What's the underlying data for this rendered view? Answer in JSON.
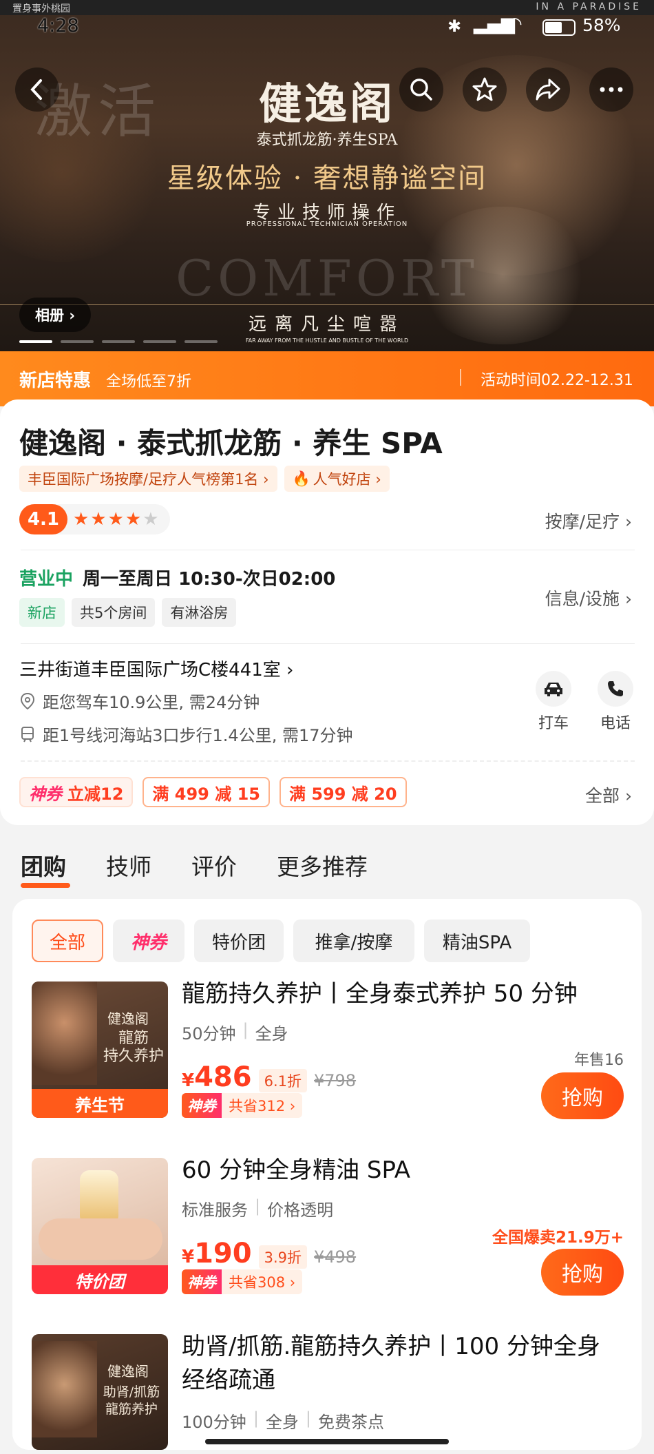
{
  "status_bar": {
    "top_left": "置身事外桃园",
    "top_right": "IN A PARADISE",
    "time": "4:28",
    "battery": "58%"
  },
  "hero": {
    "watermark_left": "激活",
    "logo_text": "健逸阁",
    "logo_sub": "泰式抓龙筋·养生SPA",
    "slogan": "星级体验 · 奢想静谧空间",
    "subline_cn": "专业技师操作",
    "subline_en": "PROFESSIONAL TECHNICIAN OPERATION",
    "watermark_en": "COMFORT",
    "bottom_cn": "远离凡尘喧嚣",
    "bottom_en": "FAR AWAY FROM THE HUSTLE AND BUSTLE OF THE WORLD",
    "album_label": "相册 ›"
  },
  "promo": {
    "title": "新店特惠",
    "desc": "全场低至7折",
    "period": "活动时间02.22-12.31"
  },
  "shop": {
    "name": "健逸阁 · 泰式抓龙筋 · 养生 SPA",
    "rank_tag": "丰臣国际广场按摩/足疗人气榜第1名 ›",
    "hot_tag": "人气好店 ›",
    "rating": "4.1",
    "category": "按摩/足疗 ›",
    "open_status": "营业中",
    "hours": "周一至周日 10:30-次日02:00",
    "tags": [
      "新店",
      "共5个房间",
      "有淋浴房"
    ],
    "info_link": "信息/设施 ›",
    "address": "三井街道丰臣国际广场C楼441室 ›",
    "drive_info": "距您驾车10.9公里, 需24分钟",
    "metro_info": "距1号线河海站3口步行1.4公里, 需17分钟",
    "taxi_label": "打车",
    "phone_label": "电话",
    "coupons": [
      {
        "brand": "神券",
        "text": "立减12"
      },
      {
        "text": "满 499 减 15"
      },
      {
        "text": "满 599 减 20"
      }
    ],
    "coupons_all": "全部 ›"
  },
  "tabs": [
    "团购",
    "技师",
    "评价",
    "更多推荐"
  ],
  "filters": [
    "全部",
    "神券",
    "特价团",
    "推拿/按摩",
    "精油SPA"
  ],
  "deals": [
    {
      "title": "龍筋持久养护丨全身泰式养护 50 分钟",
      "sub": [
        "50分钟",
        "全身"
      ],
      "currency": "¥",
      "price": "486",
      "discount": "6.1折",
      "original": "¥798",
      "shen": "神券",
      "save": "共省312 ›",
      "sales": "年售16",
      "buy": "抢购",
      "thumb_badge": "养生节",
      "thumb_logo": "健逸阁",
      "thumb_text": "龍筋\n持久养护"
    },
    {
      "title": "60 分钟全身精油 SPA",
      "sub": [
        "标准服务",
        "价格透明"
      ],
      "currency": "¥",
      "price": "190",
      "discount": "3.9折",
      "original": "¥498",
      "shen": "神券",
      "save": "共省308 ›",
      "sales": "全国爆卖21.9万+",
      "buy": "抢购",
      "thumb_badge": "特价团"
    },
    {
      "title": "助肾/抓筋.龍筋持久养护丨100 分钟全身经络疏通",
      "sub": [
        "100分钟",
        "全身",
        "免费茶点"
      ],
      "thumb_logo": "健逸阁",
      "thumb_text": "助肾/抓筋\n龍筋养护"
    }
  ],
  "colors": {
    "accent": "#ff5a1a",
    "open_green": "#1aa260",
    "price_red": "#ff3d1f"
  }
}
